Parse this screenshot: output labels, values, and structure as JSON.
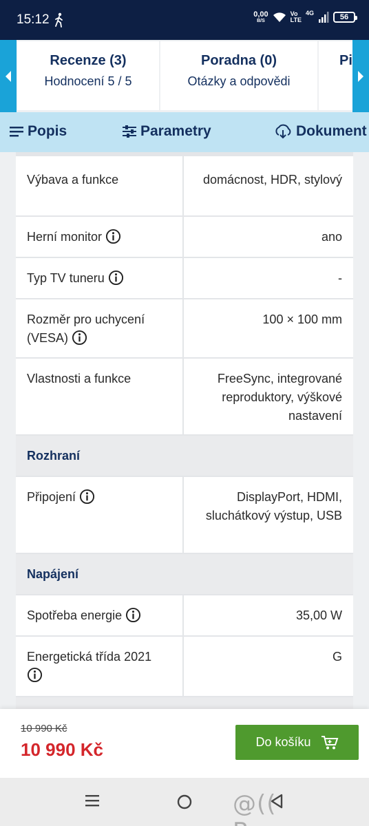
{
  "status": {
    "time": "15:12",
    "net_speed": "0,00",
    "net_unit": "B/S",
    "volte_top": "Vo",
    "volte_bottom": "LTE",
    "network": "4G",
    "battery": "56"
  },
  "tabs": [
    {
      "title": "Recenze (3)",
      "sub": "Hodnocení 5 / 5"
    },
    {
      "title": "Poradna (0)",
      "sub": "Otázky a odpovědi"
    },
    {
      "title": "Pi",
      "sub": ""
    }
  ],
  "section_nav": {
    "popis": "Popis",
    "parametry": "Parametry",
    "dokumenty": "Dokument"
  },
  "specs": {
    "vybava": {
      "label": "Výbava a funkce",
      "value": "domácnost, HDR, stylový"
    },
    "herni": {
      "label": "Herní monitor",
      "value": "ano"
    },
    "tuner": {
      "label": "Typ TV tuneru",
      "value": "-"
    },
    "vesa": {
      "label": "Rozměr pro uchycení (VESA)",
      "value": "100 × 100 mm"
    },
    "vlastnosti": {
      "label": "Vlastnosti a funkce",
      "value": "FreeSync, integrované reproduktory, výškové nastavení"
    },
    "group_rozhrani": "Rozhraní",
    "pripojeni": {
      "label": "Připojení",
      "value": "DisplayPort, HDMI, sluchátkový výstup, USB"
    },
    "group_napajeni": "Napájení",
    "spotreba": {
      "label": "Spotřeba energie",
      "value": "35,00 W"
    },
    "trida": {
      "label": "Energetická třída 2021",
      "value": "G"
    }
  },
  "buy": {
    "old_price": "10 990 Kč",
    "price": "10 990 Kč",
    "button": "Do košíku"
  },
  "watermark": "@(( Bazos.cz",
  "colors": {
    "navy": "#14305f",
    "accent_blue": "#1aa3d8",
    "nav_bg": "#bfe3f3",
    "cart_green": "#4f9a2e",
    "price_red": "#d4262b"
  }
}
